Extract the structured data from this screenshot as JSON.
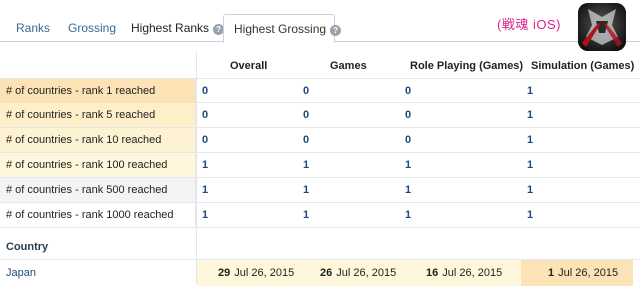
{
  "tabs": [
    {
      "label": "Ranks"
    },
    {
      "label": "Grossing"
    },
    {
      "label": "Highest Ranks"
    },
    {
      "label": "Highest Grossing"
    }
  ],
  "app": {
    "title": "(戦魂 iOS)"
  },
  "columns": [
    "Overall",
    "Games",
    "Role Playing (Games)",
    "Simulation (Games)"
  ],
  "rows": [
    {
      "label": "# of countries - rank 1 reached",
      "values": [
        "0",
        "0",
        "0",
        "1"
      ]
    },
    {
      "label": "# of countries - rank 5 reached",
      "values": [
        "0",
        "0",
        "0",
        "1"
      ]
    },
    {
      "label": "# of countries - rank 10 reached",
      "values": [
        "0",
        "0",
        "0",
        "1"
      ]
    },
    {
      "label": "# of countries - rank 100 reached",
      "values": [
        "1",
        "1",
        "1",
        "1"
      ]
    },
    {
      "label": "# of countries - rank 500 reached",
      "values": [
        "1",
        "1",
        "1",
        "1"
      ]
    },
    {
      "label": "# of countries - rank 1000 reached",
      "values": [
        "1",
        "1",
        "1",
        "1"
      ]
    }
  ],
  "country_section": {
    "header": "Country"
  },
  "countries": [
    {
      "name": "Japan",
      "ranks": [
        {
          "rank": "29",
          "date": "Jul 26, 2015"
        },
        {
          "rank": "26",
          "date": "Jul 26, 2015"
        },
        {
          "rank": "16",
          "date": "Jul 26, 2015"
        },
        {
          "rank": "1",
          "date": "Jul 26, 2015"
        }
      ]
    }
  ],
  "colors": {
    "rank1": "#fbe3b5",
    "rank5": "#fdf0c9",
    "rank10": "#fdf3d2",
    "rank100": "#fef7dc",
    "rank500": "#f4f4f4",
    "rank1000": "#ffffff",
    "accent_pink": "#e0218a",
    "link_blue": "#1f4a7a"
  },
  "icons": {
    "help": "question-circle-icon",
    "app": "app-icon"
  }
}
